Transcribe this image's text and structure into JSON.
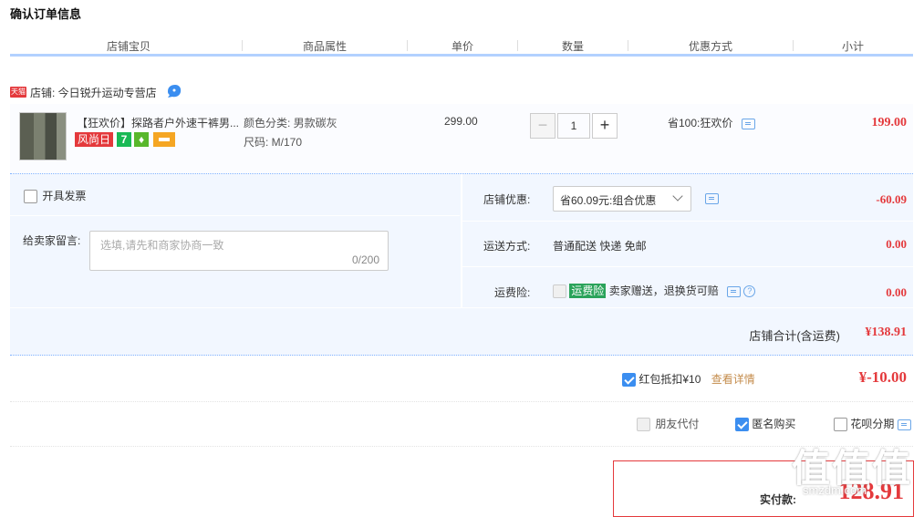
{
  "page_title": "确认订单信息",
  "columns": [
    "店铺宝贝",
    "商品属性",
    "单价",
    "数量",
    "优惠方式",
    "小计"
  ],
  "shop": {
    "badge": "天猫",
    "name": "店铺: 今日锐升运动专营店"
  },
  "item": {
    "name": "【狂欢价】探路者户外速干裤男...",
    "tags": {
      "fengshangri": "风尚日",
      "seven": "7",
      "g": "♦"
    },
    "attr_color": "颜色分类: 男款碳灰",
    "attr_size": "尺码: M/170",
    "price": "299.00",
    "qty_minus": "−",
    "qty": "1",
    "qty_plus": "+",
    "discount": "省100:狂欢价",
    "subtotal": "199.00"
  },
  "invoice": {
    "label": "开具发票"
  },
  "memo": {
    "label": "给卖家留言:",
    "placeholder": "选填,请先和商家协商一致",
    "count": "0/200"
  },
  "shop_discount": {
    "label": "店铺优惠:",
    "selected": "省60.09元:组合优惠",
    "value": "-60.09"
  },
  "shipping": {
    "label": "运送方式:",
    "value_text": "普通配送 快递 免邮",
    "value": "0.00"
  },
  "insurance": {
    "label": "运费险:",
    "tag": "运费险",
    "desc": "卖家赠送，退换货可赔",
    "help": "?",
    "value": "0.00"
  },
  "shop_total": {
    "label": "店铺合计(含运费)",
    "value": "¥138.91"
  },
  "redpacket": {
    "label": "红包抵扣¥10",
    "link": "查看详情",
    "value": "¥-10.00"
  },
  "pay_options": {
    "friend": "朋友代付",
    "anonymous": "匿名购买",
    "huabei": "花呗分期"
  },
  "payment": {
    "label": "实付款:",
    "value": "128.91"
  },
  "watermark": {
    "logo": "值值值",
    "site": "smzdm.com"
  }
}
